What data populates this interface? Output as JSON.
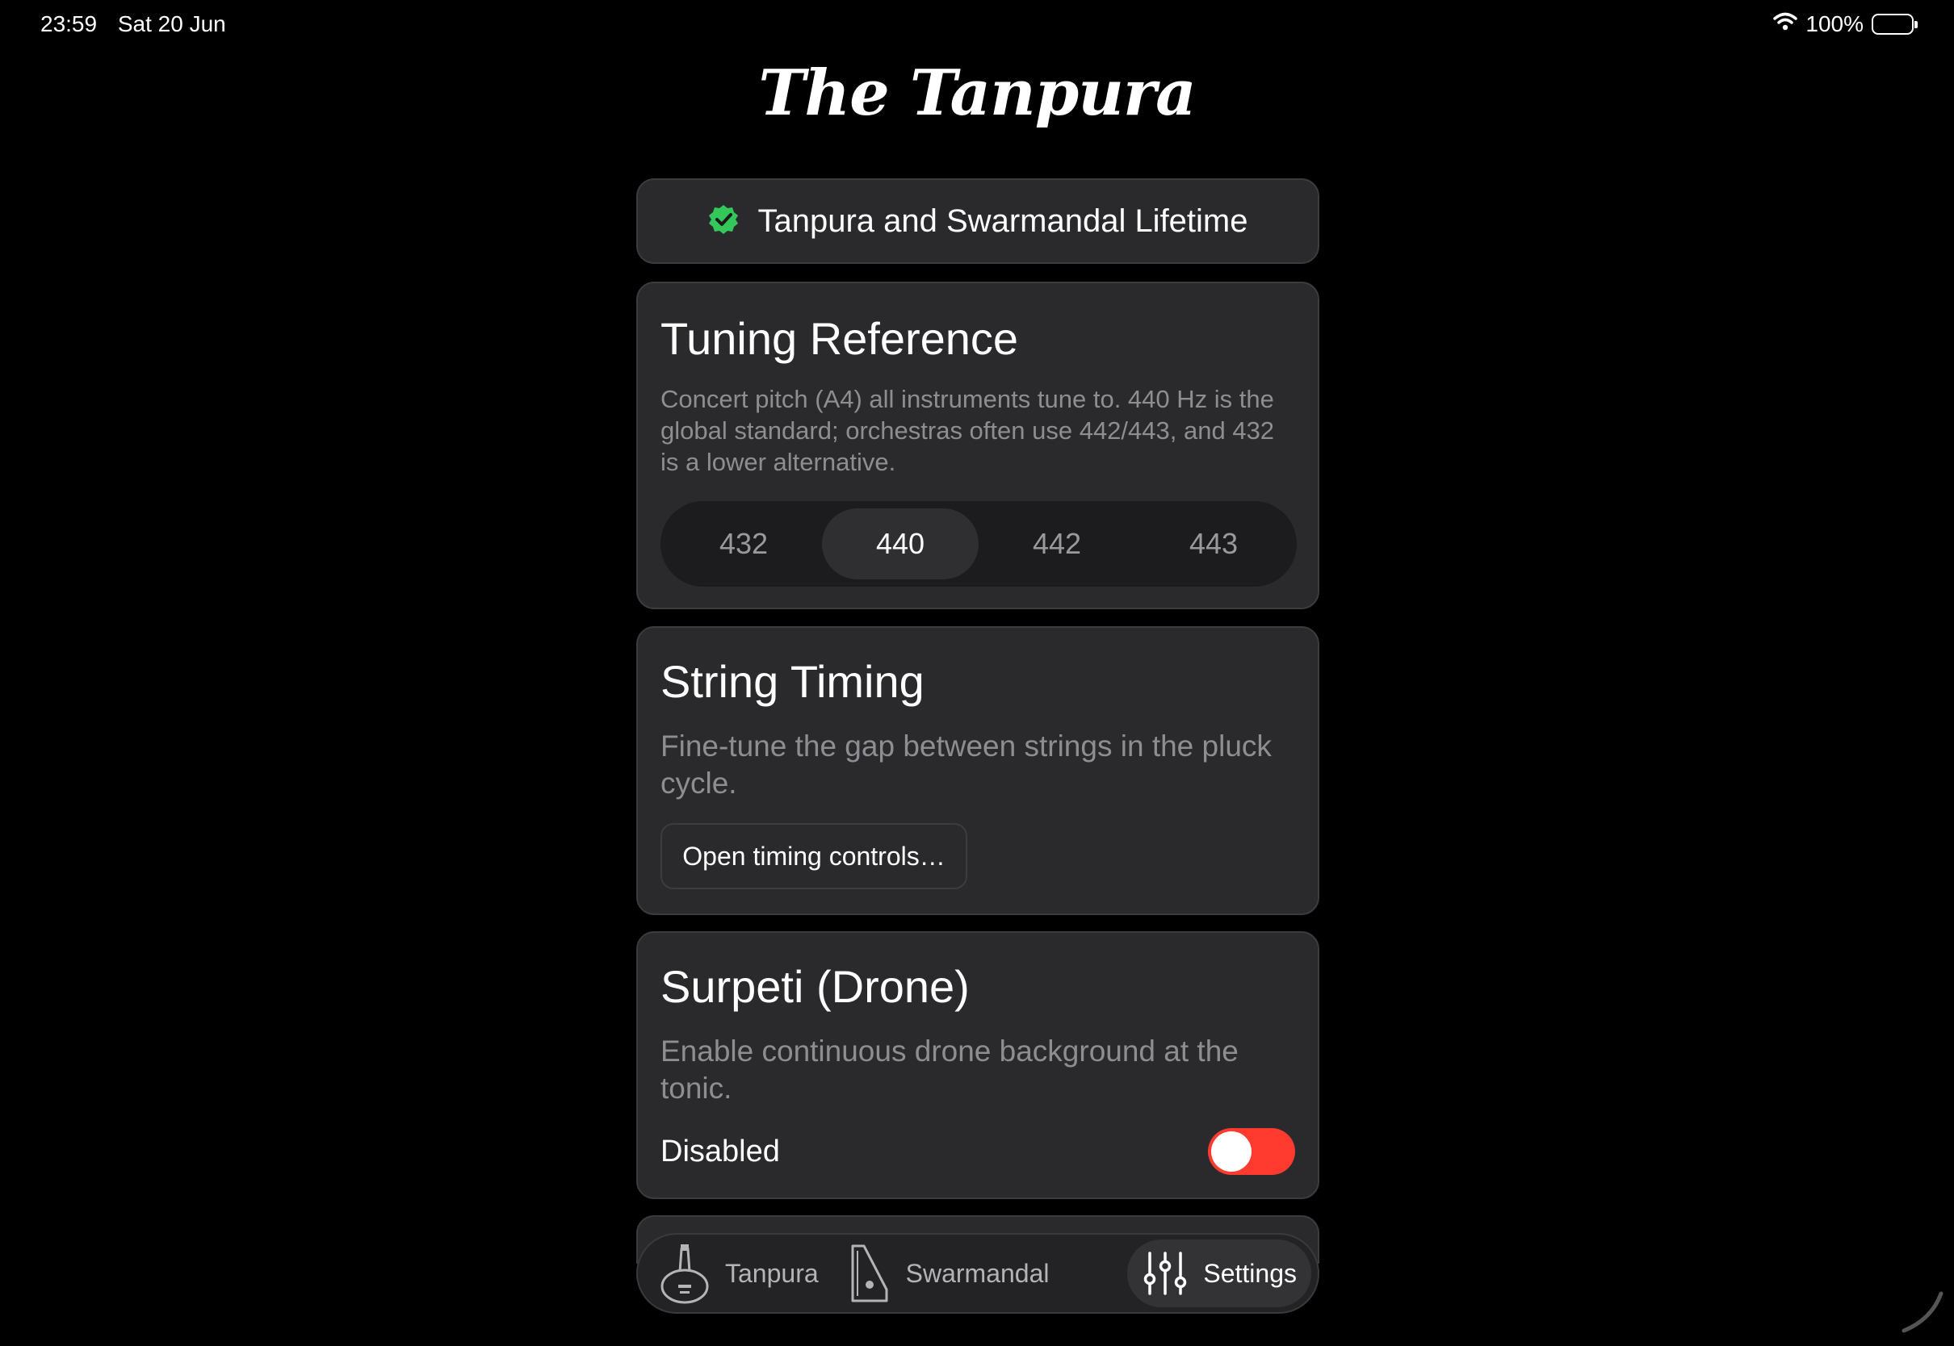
{
  "status_bar": {
    "time": "23:59",
    "date": "Sat 20 Jun",
    "battery": "100%"
  },
  "app": {
    "logo": "The Tanpura"
  },
  "purchase": {
    "label": "Tanpura and Swarmandal Lifetime",
    "icon": "verified-badge-icon",
    "icon_color": "#34c759"
  },
  "tuning": {
    "title": "Tuning Reference",
    "description": "Concert pitch (A4) all instruments tune to. 440 Hz is the global standard; orchestras often use 442/443, and 432 is a lower alternative.",
    "options": [
      "432",
      "440",
      "442",
      "443"
    ],
    "selected": "440"
  },
  "timing": {
    "title": "String Timing",
    "description": "Fine-tune the gap between strings in the pluck cycle.",
    "button": "Open timing controls…"
  },
  "drone": {
    "title": "Surpeti (Drone)",
    "description": "Enable continuous drone background at the tonic.",
    "status": "Disabled",
    "toggle_color": "#ff3b30"
  },
  "tabs": [
    {
      "label": "Tanpura",
      "icon": "tanpura-icon"
    },
    {
      "label": "Swarmandal",
      "icon": "swarmandal-icon"
    },
    {
      "label": "Settings",
      "icon": "sliders-icon",
      "active": true
    }
  ]
}
